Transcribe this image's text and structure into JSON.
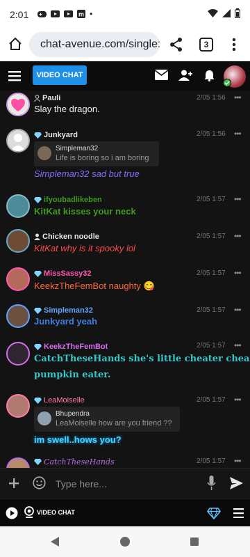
{
  "status": {
    "time": "2:01",
    "dot": "•"
  },
  "browser": {
    "url": "chat-avenue.com/single:",
    "tab_count": "3"
  },
  "header": {
    "video_chat_label": "VIDEO CHAT"
  },
  "messages": [
    {
      "user": "Pauli",
      "role": "user",
      "time": "2/05 1:56",
      "text": "Slay the dragon.",
      "name_color": "#e6e6e6",
      "text_color": "#f0f0f0"
    },
    {
      "user": "Junkyard",
      "role": "vip",
      "time": "2/05 1:56",
      "quote_user": "Simpleman32",
      "quote_text": "Life is boring so i am boring",
      "text": "Simpleman32 sad but true",
      "name_color": "#e6e6e6",
      "text_color": "#8a6bff"
    },
    {
      "user": "ifyoubadlikeben",
      "role": "vip",
      "time": "2/05 1:57",
      "text": "KitKat kisses your neck",
      "name_color": "#3f9a20",
      "text_color": "#3f9a20"
    },
    {
      "user": "Chicken noodle",
      "role": "user",
      "time": "2/05 1:57",
      "text": "KitKat why is it spooky lol",
      "name_color": "#e6e6e6",
      "text_color": "#ff4747"
    },
    {
      "user": "MissSassy32",
      "role": "vip",
      "time": "2/05 1:57",
      "text": "KeekzTheFemBot naughty 😋",
      "name_color": "#ff59b0",
      "text_color": "#ff6a3d"
    },
    {
      "user": "Simpleman32",
      "role": "vip",
      "time": "2/05 1:57",
      "text": "Junkyard yeah",
      "name_color": "#5aa4ff",
      "text_color": "#3d7ee0"
    },
    {
      "user": "KeekzTheFemBot",
      "role": "vip",
      "time": "2/05 1:57",
      "text": "CatchTheseHands she's little cheater cheater",
      "text2": "pumpkin eater.",
      "name_color": "#d66bf0",
      "text_color": "#36c6c8"
    },
    {
      "user": "LeaMoiselle",
      "role": "vip",
      "time": "2/05 1:57",
      "quote_user": "Bhupendra",
      "quote_text": "LeaMoiselle how are you friend ??",
      "text": "im swell..hows you?",
      "name_color": "#ff7aa8",
      "text_color": "#43d8ff"
    },
    {
      "user": "CatchTheseHands",
      "role": "vip",
      "time": "2/05 1:57",
      "name_color": "#b070e8"
    }
  ],
  "composer": {
    "placeholder": "Type here..."
  },
  "footer": {
    "video_chat_label": "VIDEO CHAT"
  },
  "icons": {
    "dots": "•••"
  }
}
